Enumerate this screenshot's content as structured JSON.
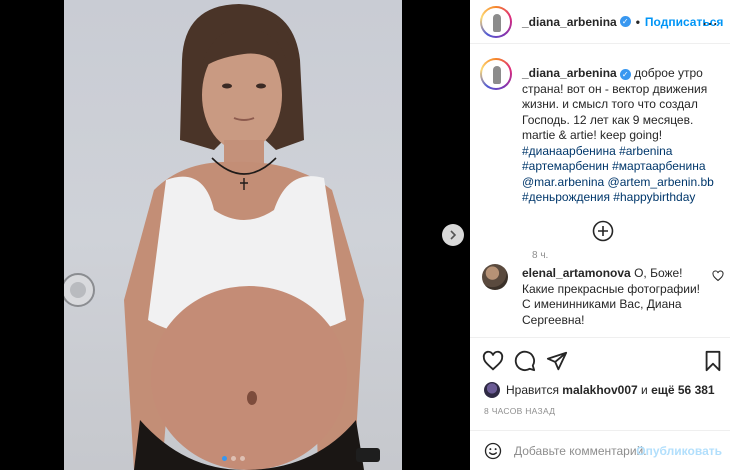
{
  "post": {
    "author": "_diana_arbenina",
    "follow_label": "Подписаться",
    "separator": "•",
    "more_label": "⋯"
  },
  "caption": {
    "author": "_diana_arbenina",
    "text": "доброе утро страна! вот он - вектор движения жизни. и смысл того что создал Господь. 12 лет как 9 месяцев. martie & artie! keep going!",
    "tags": "#дианаарбенина #arbenina #артемарбенин #мартаарбенина @mar.arbenina @artem_arbenin.bb #деньрождения #happybirthday",
    "time": "8 ч."
  },
  "comment": {
    "author": "elenal_artamonova",
    "text": "О, Боже! Какие прекрасные фотографии! С именинниками Вас, Диана Сергеевна!"
  },
  "likes": {
    "prefix": "Нравится",
    "user": "malakhov007",
    "middle": "и",
    "count_text": "ещё 56 381"
  },
  "post_time": "8 ЧАСОВ НАЗАД",
  "add_comment": {
    "placeholder": "Добавьте комментарий...",
    "publish_label": "Опубликовать"
  },
  "carousel": {
    "slides": 3,
    "active": 0
  },
  "colors": {
    "accent": "#0095f6",
    "verified": "#3897f0",
    "publish_disabled": "#b2dffc"
  }
}
